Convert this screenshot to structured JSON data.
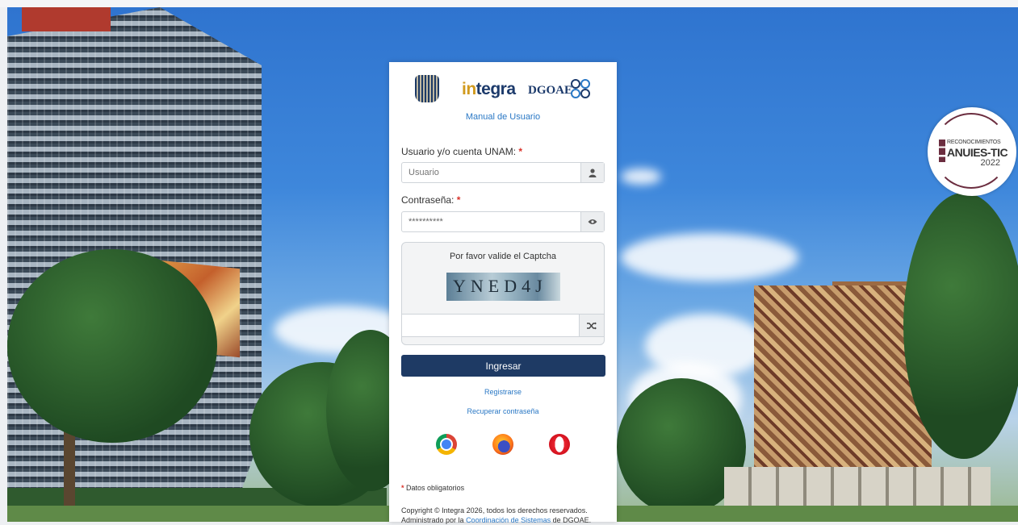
{
  "brand": {
    "integra_prefix": "in",
    "integra_suffix": "tegra",
    "dgoae": "DGOAE"
  },
  "badge": {
    "line1": "RECONOCIMIENTOS",
    "line2": "ANUIES-TIC",
    "line3": "2022"
  },
  "login": {
    "manual_link": "Manual de Usuario",
    "user_label": "Usuario y/o cuenta UNAM:",
    "user_placeholder": "Usuario",
    "password_label": "Contraseña:",
    "password_value": "**********",
    "required_mark": "*",
    "captcha_title": "Por favor valide el Captcha",
    "captcha_text": "YNED4J",
    "captcha_value": "",
    "submit_label": "Ingresar",
    "register_link": "Registrarse",
    "recover_link": "Recuperar contraseña"
  },
  "footer": {
    "required_note": "Datos obligatorios",
    "copyright": "Copyright © Integra 2026, todos los derechos reservados.",
    "admin_prefix": "Administrado por la",
    "admin_link": "Coordinación de Sistemas",
    "admin_suffix": "de DGOAE."
  },
  "icons": {
    "user": "user-icon",
    "password_toggle": "eye-icon",
    "captcha_refresh": "shuffle-icon",
    "browsers": [
      "chrome-icon",
      "firefox-icon",
      "opera-icon"
    ]
  },
  "colors": {
    "primary_button": "#1e3a64",
    "link": "#2a78c5",
    "required": "#d9332a"
  }
}
